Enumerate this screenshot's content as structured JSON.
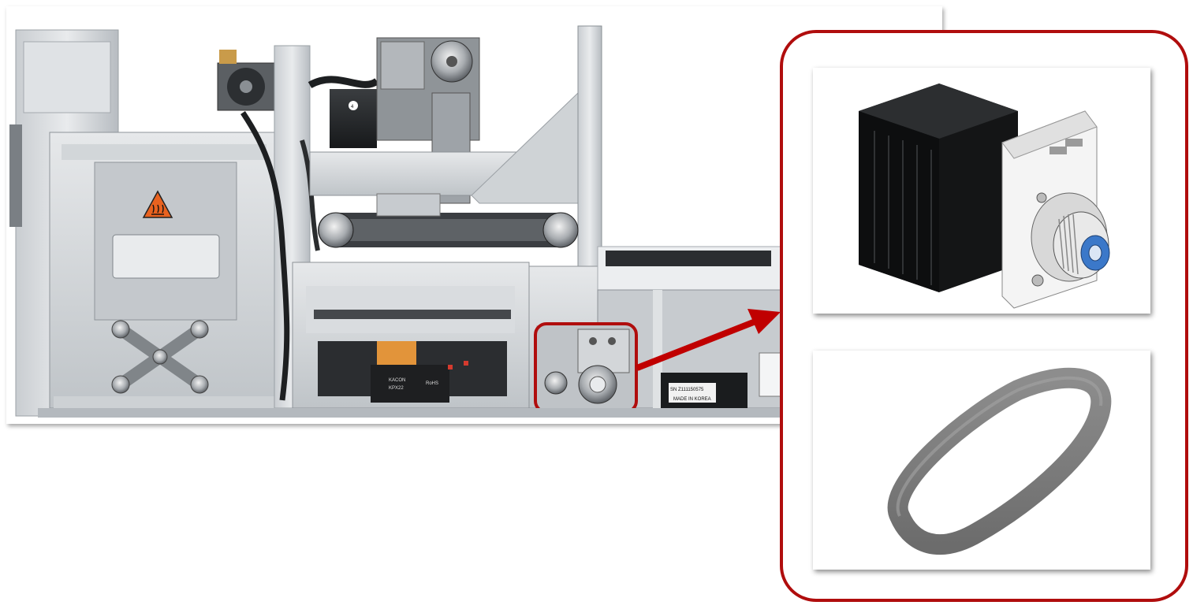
{
  "photo": {
    "hazard_symbol": "hot-surface-warning-icon",
    "labels": {
      "motor_number": "4",
      "relay_brand": "KACON",
      "relay_model": "KPX22",
      "relay_mark": "RoHS",
      "serial_number": "SN Z111150575",
      "made_in": "MADE IN KOREA"
    }
  },
  "callout": {
    "frame_color": "#b00d0d",
    "arrow_color": "#c00000",
    "highlight_target": "pulley-motor-assembly",
    "parts": [
      {
        "name": "stepper-motor-with-pulley",
        "icon": "motor-icon"
      },
      {
        "name": "timing-belt",
        "icon": "belt-icon"
      }
    ]
  }
}
